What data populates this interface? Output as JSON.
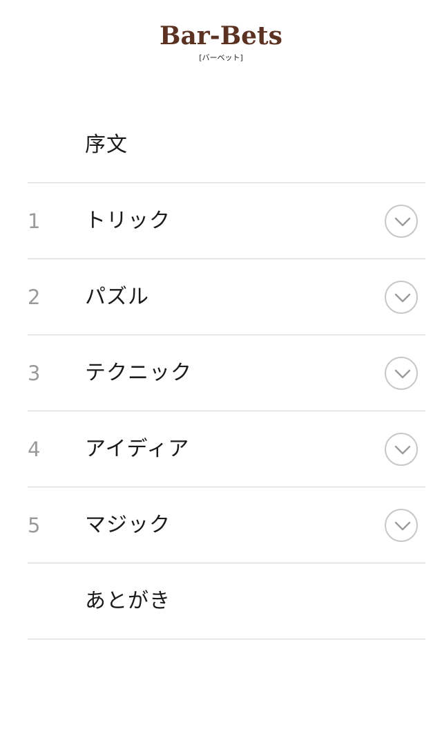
{
  "header": {
    "title": "Bar-Bets",
    "subtitle": "[バーベット]",
    "title_color": "#5b3222"
  },
  "menu": {
    "items": [
      {
        "number": "",
        "label": "序文",
        "expandable": false
      },
      {
        "number": "1",
        "label": "トリック",
        "expandable": true,
        "icon": "chevron-down-icon"
      },
      {
        "number": "2",
        "label": "パズル",
        "expandable": true,
        "icon": "chevron-down-icon"
      },
      {
        "number": "3",
        "label": "テクニック",
        "expandable": true,
        "icon": "chevron-down-icon"
      },
      {
        "number": "4",
        "label": "アイディア",
        "expandable": true,
        "icon": "chevron-down-icon"
      },
      {
        "number": "5",
        "label": "マジック",
        "expandable": true,
        "icon": "chevron-down-icon"
      },
      {
        "number": "",
        "label": "あとがき",
        "expandable": false
      }
    ]
  },
  "colors": {
    "number": "#9a9a9a",
    "label": "#1a1a1a",
    "divider": "#d4d4d4",
    "icon": "#c8c8c8"
  }
}
